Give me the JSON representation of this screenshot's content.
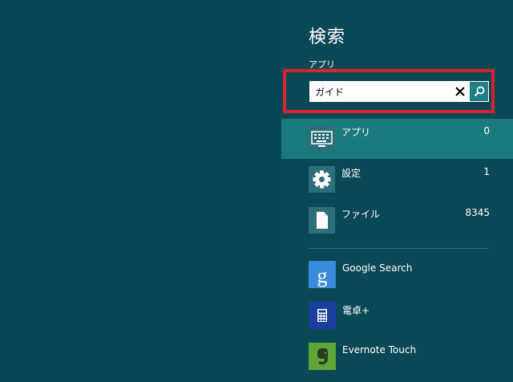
{
  "search_pane": {
    "title": "検索",
    "scope_label": "アプリ",
    "query": "ガイド",
    "categories": [
      {
        "label": "アプリ",
        "count": "0",
        "icon": "keyboard-icon",
        "selected": true
      },
      {
        "label": "設定",
        "count": "1",
        "icon": "gear-icon",
        "selected": false
      },
      {
        "label": "ファイル",
        "count": "8345",
        "icon": "file-icon",
        "selected": false
      }
    ],
    "apps": [
      {
        "label": "Google Search",
        "icon": "google-icon",
        "color": "#3c8adb"
      },
      {
        "label": "電卓+",
        "icon": "calculator-icon",
        "color": "#1b3d9c"
      },
      {
        "label": "Evernote Touch",
        "icon": "evernote-icon",
        "color": "#5ea639"
      }
    ]
  },
  "colors": {
    "pane_background": "#0b4856",
    "desktop_background": "#034656",
    "selected_row": "#1a7a7c",
    "highlight_border": "#d9232e"
  }
}
